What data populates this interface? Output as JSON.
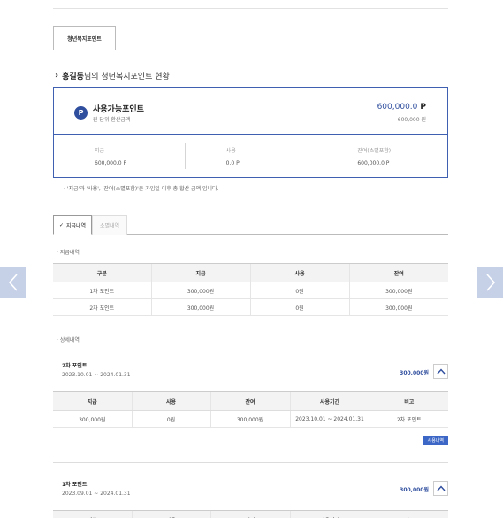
{
  "nav": {
    "prev_icon": "chevron-left-icon",
    "next_icon": "chevron-right-icon"
  },
  "main_tab": {
    "label": "청년복지포인트"
  },
  "status": {
    "chevron": "›",
    "user_name": "홍길동",
    "title_suffix": "님의 청년복지포인트 현황"
  },
  "point_box": {
    "icon_letter": "P",
    "label": "사용가능포인트",
    "sub": "원 단위 환산금액",
    "amount": "600,000.0",
    "unit": "P",
    "won": "600,000 원",
    "columns": [
      {
        "header": "지급",
        "value": "600,000.0 P"
      },
      {
        "header": "사용",
        "value": "0.0 P"
      },
      {
        "header": "잔여(소멸포함)",
        "value": "600,000.0 P"
      }
    ]
  },
  "note": "· '지급'과 '사용', '잔여(소멸포함)'은 가입일 이후 총 합산 금액 입니다.",
  "sub_tabs": {
    "active": "지급내역",
    "inactive": "소멸내역"
  },
  "summary": {
    "label": "· 지급내역",
    "headers": [
      "구분",
      "지급",
      "사용",
      "잔여"
    ],
    "rows": [
      [
        "1차 포인트",
        "300,000원",
        "0원",
        "300,000원"
      ],
      [
        "2차 포인트",
        "300,000원",
        "0원",
        "300,000원"
      ]
    ]
  },
  "detail": {
    "label": "· 상세내역",
    "headers": [
      "지급",
      "사용",
      "잔여",
      "사용기간",
      "비고"
    ],
    "items": [
      {
        "title": "2차 포인트",
        "period": "2023.10.01 ~ 2024.01.31",
        "amount": "300,000원",
        "row": [
          "300,000원",
          "0원",
          "300,000원",
          "2023.10.01 ~ 2024.01.31",
          "2차 포인트"
        ],
        "usage_button": "사용내역"
      },
      {
        "title": "1차 포인트",
        "period": "2023.09.01 ~ 2024.01.31",
        "amount": "300,000원"
      }
    ]
  },
  "colors": {
    "accent": "#2f4e9e",
    "border_blue": "#3f5fb0",
    "button_blue": "#3d67c6",
    "arrow_bg": "#c6d1e8"
  }
}
